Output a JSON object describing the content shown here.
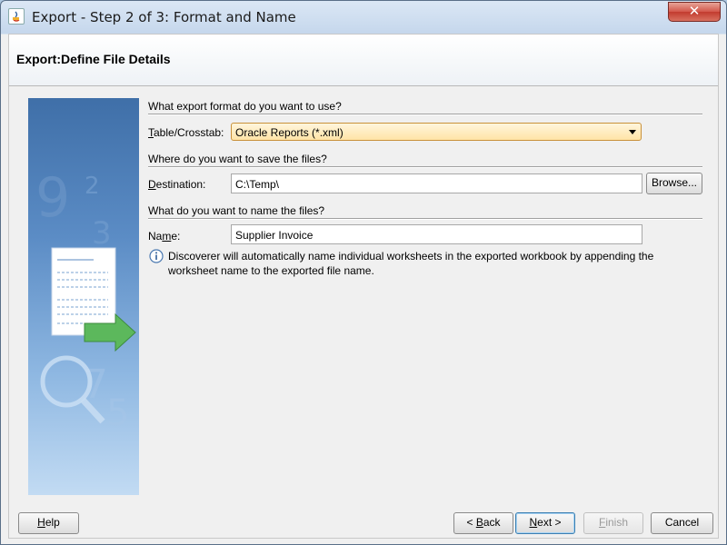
{
  "window": {
    "title": "Export - Step 2 of 3: Format and Name",
    "close_label": "✕"
  },
  "header": {
    "title": "Export:Define File Details"
  },
  "format_section": {
    "label": "What export format do you want to use?",
    "field_label_first": "T",
    "field_label_rest": "able/Crosstab:",
    "selected": "Oracle Reports (*.xml)"
  },
  "destination_section": {
    "label": "Where do you want to save the files?",
    "field_label_first": "D",
    "field_label_rest": "estination:",
    "value": "C:\\Temp\\",
    "browse_label": "Browse..."
  },
  "name_section": {
    "label": "What do you want to name the files?",
    "field_label_pre": "Na",
    "field_label_u": "m",
    "field_label_post": "e:",
    "value": "Supplier Invoice",
    "info_line1": "Discoverer will automatically name individual worksheets in the exported workbook by appending the",
    "info_line2": "worksheet name to the exported file name."
  },
  "buttons": {
    "help_u": "H",
    "help_rest": "elp",
    "back_pre": "< ",
    "back_u": "B",
    "back_rest": "ack",
    "next_u": "N",
    "next_rest": "ext >",
    "finish_u": "F",
    "finish_rest": "inish",
    "cancel": "Cancel"
  },
  "colors": {
    "combo_border": "#c9913a",
    "default_button_border": "#3c7fb1",
    "close_button": "#c23b2f"
  }
}
